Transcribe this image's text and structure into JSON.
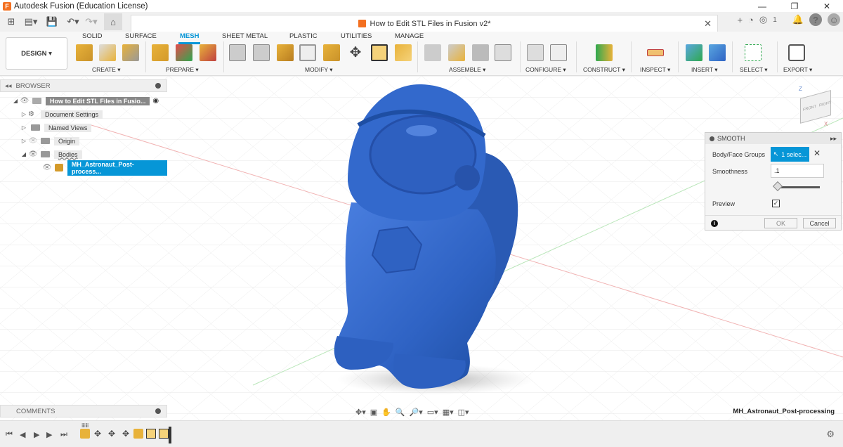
{
  "window": {
    "title": "Autodesk Fusion (Education License)",
    "controls": [
      "—",
      "❐",
      "✕"
    ]
  },
  "appbar": {
    "doc_title": "How to Edit STL Files in Fusion v2*",
    "notification_count": "1"
  },
  "ribbon": {
    "workspace_tabs": [
      "SOLID",
      "SURFACE",
      "MESH",
      "SHEET METAL",
      "PLASTIC",
      "UTILITIES",
      "MANAGE"
    ],
    "active_tab": "MESH",
    "design_label": "DESIGN ▾",
    "groups": [
      "CREATE ▾",
      "PREPARE ▾",
      "MODIFY ▾",
      "ASSEMBLE ▾",
      "CONFIGURE ▾",
      "CONSTRUCT ▾",
      "INSPECT ▾",
      "INSERT ▾",
      "SELECT ▾",
      "EXPORT ▾"
    ]
  },
  "browser": {
    "header": "BROWSER",
    "root": "How to Edit STL Files in Fusio...",
    "items": [
      "Document Settings",
      "Named Views",
      "Origin",
      "Bodies"
    ],
    "body_item": "MH_Astronaut_Post-process..."
  },
  "smooth_dialog": {
    "title": "SMOOTH",
    "face_groups_label": "Body/Face Groups",
    "selection": "1 selec...",
    "smoothness_label": "Smoothness",
    "smoothness_value": ".1",
    "preview_label": "Preview",
    "preview_checked": true,
    "ok_label": "OK",
    "cancel_label": "Cancel"
  },
  "viewcube": {
    "front": "FRONT",
    "right": "RIGHT",
    "axis_z": "Z",
    "axis_x": "X"
  },
  "comments": {
    "header": "COMMENTS"
  },
  "status": {
    "body_name": "MH_Astronaut_Post-processing"
  },
  "colors": {
    "accent": "#0696d7",
    "mesh_body": "#2f63c4",
    "brand": "#f37021"
  }
}
